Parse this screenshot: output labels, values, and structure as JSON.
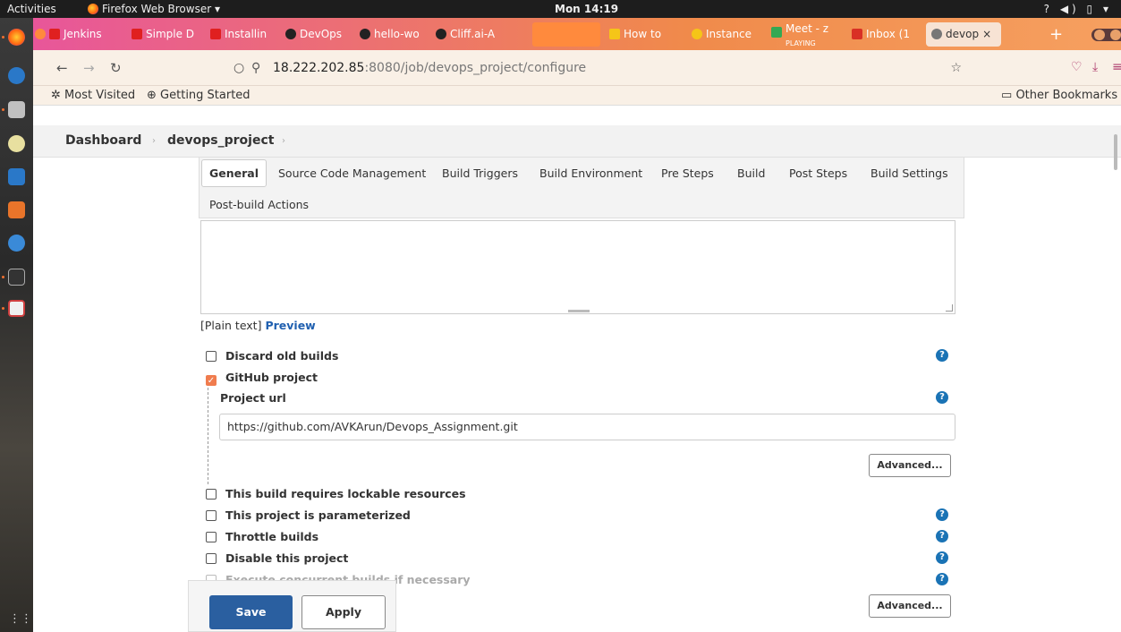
{
  "system": {
    "activities": "Activities",
    "app_name": "Firefox Web Browser ▾",
    "clock": "Mon 14:19",
    "tray": "? ◀) ▯ ▾"
  },
  "tabs": [
    {
      "label": "Jenkins",
      "color": "#e02020"
    },
    {
      "label": "Simple D",
      "color": "#e02020"
    },
    {
      "label": "Installin",
      "color": "#e02020"
    },
    {
      "label": "DevOps",
      "color": "#222222"
    },
    {
      "label": "hello-wo",
      "color": "#222222"
    },
    {
      "label": "Cliff.ai-A",
      "color": "#222222"
    },
    {
      "label": "How to",
      "color": "#f5c518"
    },
    {
      "label": "Instance",
      "color": "#f5c518"
    },
    {
      "label": "Meet - z",
      "sub": "PLAYING",
      "color": "#34a853"
    },
    {
      "label": "Inbox (1",
      "color": "#d93025"
    },
    {
      "label": "devop",
      "color": "#777777"
    }
  ],
  "nav": {
    "url_host": "18.222.202.85",
    "url_rest": ":8080/job/devops_project/configure"
  },
  "bookmarks": {
    "most_visited": "Most Visited",
    "getting_started": "Getting Started",
    "other": "Other Bookmarks"
  },
  "breadcrumb": {
    "dashboard": "Dashboard",
    "project": "devops_project"
  },
  "config_tabs": [
    "General",
    "Source Code Management",
    "Build Triggers",
    "Build Environment",
    "Pre Steps",
    "Build",
    "Post Steps",
    "Build Settings",
    "Post-build Actions"
  ],
  "description": {
    "plain": "[Plain text]",
    "preview": "Preview"
  },
  "options": {
    "discard": "Discard old builds",
    "github": "GitHub project",
    "project_url_label": "Project url",
    "project_url_value": "https://github.com/AVKArun/Devops_Assignment.git",
    "advanced": "Advanced...",
    "lockable": "This build requires lockable resources",
    "parameterized": "This project is parameterized",
    "throttle": "Throttle builds",
    "disable": "Disable this project",
    "concurrent": "Execute concurrent builds if necessary"
  },
  "footer": {
    "save": "Save",
    "apply": "Apply"
  },
  "icons": {
    "help": "?",
    "check": "✓"
  }
}
